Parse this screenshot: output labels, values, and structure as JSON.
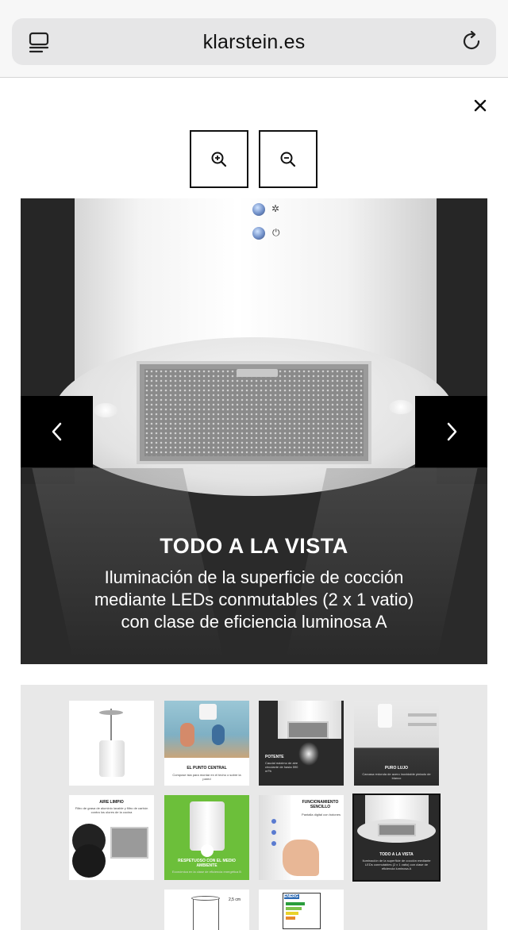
{
  "browser": {
    "url": "klarstein.es",
    "reader_icon": "reader-mode-icon",
    "reload_icon": "reload-icon"
  },
  "lightbox": {
    "close_icon": "close-icon",
    "zoom_in_icon": "zoom-in-icon",
    "zoom_out_icon": "zoom-out-icon",
    "prev_icon": "chevron-left-icon",
    "next_icon": "chevron-right-icon"
  },
  "slide": {
    "title": "TODO A LA VISTA",
    "text_line1": "Iluminación de la superficie de cocción",
    "text_line2": "mediante LEDs conmutables (2 x 1 vatio)",
    "text_line3": "con clase de eficiencia luminosa A"
  },
  "thumbnails": [
    {
      "caption": "",
      "sub": ""
    },
    {
      "caption": "EL PUNTO CENTRAL",
      "sub": "Compose isla para montar en el techo o sobre la pared"
    },
    {
      "caption": "POTENTE",
      "sub": "Caudal máximo de aire circulante de hasta 590 m³/h"
    },
    {
      "caption": "PURO LUJO",
      "sub": "Carcasa redonda de acero inoxidable pintado de blanco"
    },
    {
      "caption": "AIRE LIMPIO",
      "sub": "Filtro de grasa de aluminio lavable y filtro de carbón contra los olores de la cocina"
    },
    {
      "caption": "RESPETUOSO CON EL MEDIO AMBIENTE",
      "sub": "Económica en la clase de eficiencia energética B"
    },
    {
      "caption": "FUNCIONAMIENTO SENCILLO",
      "sub": "Pantalla digital con botones"
    },
    {
      "caption": "TODO A LA VISTA",
      "sub": "Iluminación de la superficie de cocción mediante LEDs conmutables (2 x 1 vatio) con clase de eficiencia luminosa A"
    },
    {
      "caption": "2,5 cm",
      "sub": ""
    },
    {
      "caption": "ENERG",
      "sub": ""
    }
  ],
  "colors": {
    "dark_bg": "#2a2a2a",
    "thumb_panel": "#e8e8e8",
    "eco_green": "#6cbf3a"
  }
}
